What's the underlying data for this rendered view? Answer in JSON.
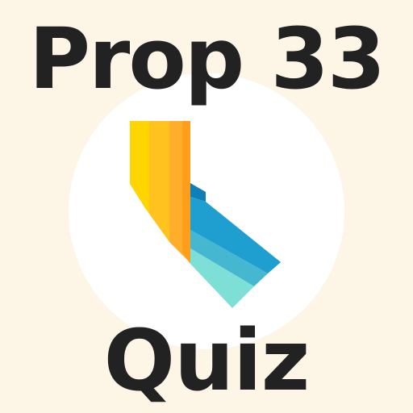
{
  "title": {
    "line1": "Prop 33",
    "line2": "Quiz"
  },
  "colors": {
    "background": "#FDF5E6",
    "circle": "#FFFFFF",
    "text": "#222222",
    "north_stripes": [
      "#FFD500",
      "#FFC21F",
      "#FFAE2B",
      "#FF9E1B"
    ],
    "south_stripes": [
      "#0F7FB8",
      "#1E9FD0",
      "#45B7D1",
      "#7EDFD6"
    ]
  },
  "icons": {
    "state_shape": "california-map-icon"
  }
}
